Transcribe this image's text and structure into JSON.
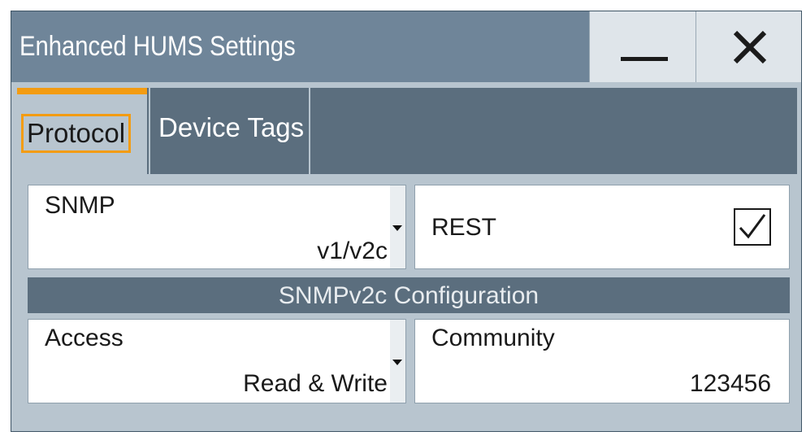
{
  "window": {
    "title": "Enhanced HUMS Settings",
    "minimize_icon": "minimize-icon",
    "close_icon": "close-icon"
  },
  "tabs": [
    {
      "label": "Protocol",
      "active": true
    },
    {
      "label": "Device Tags",
      "active": false
    }
  ],
  "protocol": {
    "snmp": {
      "label": "SNMP",
      "value": "v1/v2c"
    },
    "rest": {
      "label": "REST",
      "checked": true
    },
    "section_title": "SNMPv2c Configuration",
    "access": {
      "label": "Access",
      "value": "Read & Write"
    },
    "community": {
      "label": "Community",
      "value": "123456"
    }
  },
  "colors": {
    "title_bar": "#6f8599",
    "tab_accent": "#f39c12",
    "panel_bg": "#b8c5cf",
    "header_bg": "#5b6e7e"
  }
}
